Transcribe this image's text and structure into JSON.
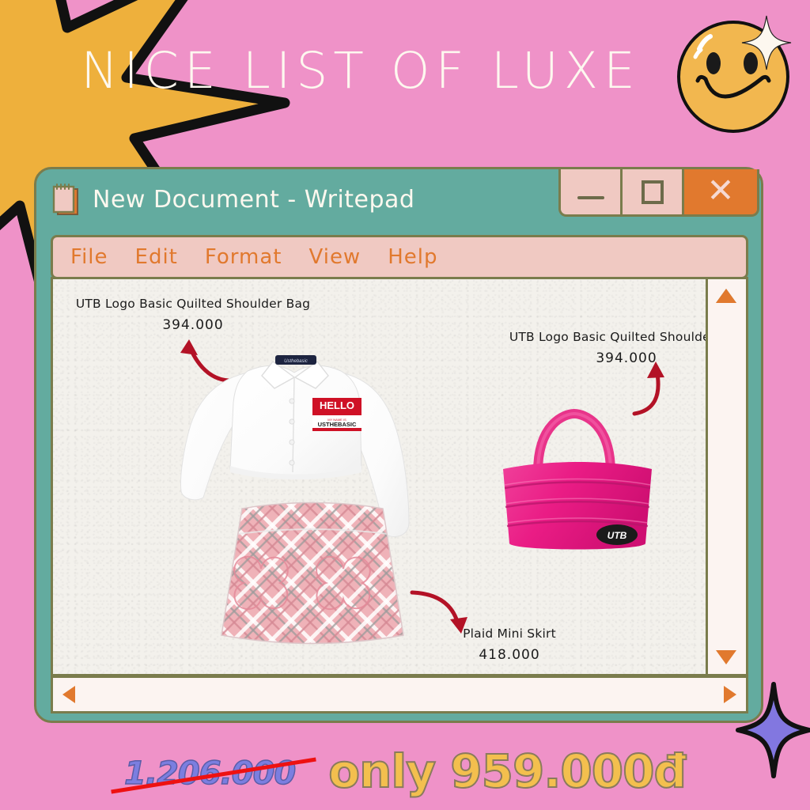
{
  "poster": {
    "headline": "NICE LIST OF LUXE",
    "background_color": "#ef92c8",
    "star_color": "#eeb03c",
    "smiley_color": "#f2b74f"
  },
  "window": {
    "title": "New Document - Writepad",
    "icon": "notepad-icon",
    "frame_color": "#63ab9f",
    "border_color": "#7a7c4c",
    "controls": {
      "minimize_label": "—",
      "maximize_label": "❐",
      "close_label": "✕"
    },
    "menu": [
      {
        "label": "File"
      },
      {
        "label": "Edit"
      },
      {
        "label": "Format"
      },
      {
        "label": "View"
      },
      {
        "label": "Help"
      }
    ],
    "menu_text_color": "#e1792e",
    "menu_bg_color": "#f0c9c2"
  },
  "document": {
    "annotations": [
      {
        "name": "UTB Logo Basic Quilted Shoulder Bag",
        "price": "394.000",
        "position": "top-left"
      },
      {
        "name": "UTB Logo Basic Quilted Shoulder Bag",
        "price": "394.000",
        "position": "top-right"
      },
      {
        "name": "Plaid Mini Skirt",
        "price": "418.000",
        "position": "bottom-center"
      }
    ],
    "products": [
      {
        "id": "shirt",
        "badge_text": "HELLO",
        "badge_sub": "MY NAME IS",
        "brand_text": "USTHEBASIC"
      },
      {
        "id": "skirt",
        "pattern": "plaid",
        "color": "#efb2b8"
      },
      {
        "id": "bag",
        "logo_text": "UTB",
        "color": "#e8348a"
      }
    ],
    "scrollbar": {
      "up_arrow": "▲",
      "down_arrow": "▼",
      "left_arrow": "◀",
      "right_arrow": "▶"
    }
  },
  "pricing": {
    "old_price": "1.206.000",
    "new_price": "only 959.000đ",
    "old_price_color": "#7b7ee0",
    "new_price_color": "#f3bf4e",
    "strike_color": "#ee1111"
  }
}
